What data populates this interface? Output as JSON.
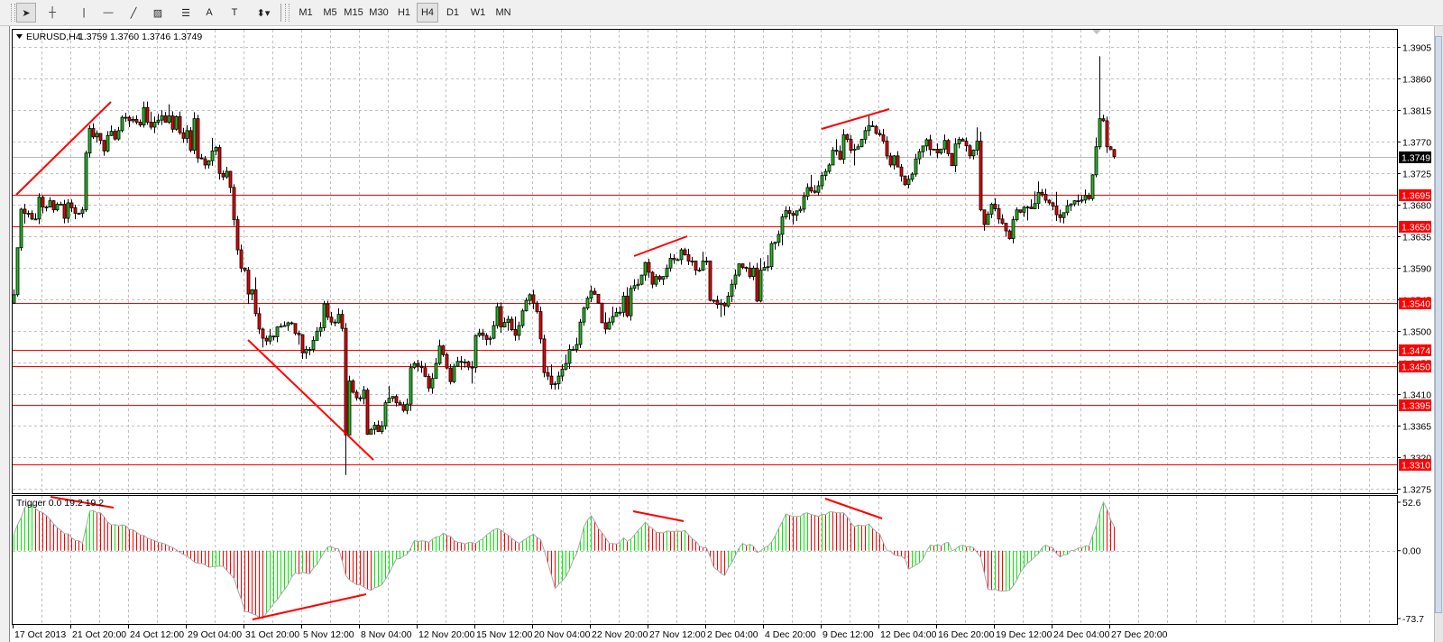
{
  "toolbar": {
    "tools": [
      {
        "name": "cursor",
        "glyph": "➤"
      },
      {
        "name": "crosshair",
        "glyph": "┼"
      },
      {
        "name": "vertical-line",
        "glyph": "|"
      },
      {
        "name": "horizontal-line",
        "glyph": "—"
      },
      {
        "name": "trendline",
        "glyph": "╱"
      },
      {
        "name": "equidistant-channel",
        "glyph": "▨"
      },
      {
        "name": "fibonacci",
        "glyph": "☰"
      },
      {
        "name": "text",
        "glyph": "A"
      },
      {
        "name": "text-label",
        "glyph": "T"
      },
      {
        "name": "arrows",
        "glyph": "⬍▾"
      }
    ],
    "timeframes": [
      "M1",
      "M5",
      "M15",
      "M30",
      "H1",
      "H4",
      "D1",
      "W1",
      "MN"
    ],
    "active_timeframe": "H4"
  },
  "chart": {
    "title": "EURUSD,H4",
    "ohlc": "1.3759 1.3760 1.3746 1.3749",
    "current_price": "1.3749",
    "indicator_label": "Trigger 0.0 19.2 19.2",
    "colors": {
      "bull": "#21b821",
      "bear": "#e60000",
      "level": "#ff0000",
      "hist_up": "#00ee00",
      "hist_down": "#ff0000",
      "line": "#a8a8a8",
      "grid": "#c0c0c0"
    }
  },
  "chart_data": {
    "type": "candlestick",
    "symbol": "EURUSD",
    "timeframe": "H4",
    "ylim": [
      1.327,
      1.392
    ],
    "price_ticks": [
      "1.3905",
      "1.3860",
      "1.3815",
      "1.3770",
      "1.3725",
      "1.3680",
      "1.3635",
      "1.3590",
      "1.3545",
      "1.3500",
      "1.3455",
      "1.3410",
      "1.3365",
      "1.3320",
      "1.3275"
    ],
    "levels": [
      "1.3695",
      "1.3650",
      "1.3540",
      "1.3474",
      "1.3450",
      "1.3395",
      "1.3310"
    ],
    "time_labels": [
      "17 Oct 2013",
      "21 Oct 20:00",
      "24 Oct 12:00",
      "29 Oct 04:00",
      "31 Oct 20:00",
      "5 Nov 12:00",
      "8 Nov 04:00",
      "12 Nov 20:00",
      "15 Nov 12:00",
      "20 Nov 04:00",
      "22 Nov 20:00",
      "27 Nov 12:00",
      "2 Dec 04:00",
      "4 Dec 20:00",
      "9 Dec 12:00",
      "12 Dec 04:00",
      "16 Dec 20:00",
      "19 Dec 12:00",
      "24 Dec 04:00",
      "27 Dec 20:00"
    ],
    "bar_count": 306,
    "first_open": 1.354,
    "close_keypoints": [
      [
        0,
        1.3552
      ],
      [
        1,
        1.3619
      ],
      [
        2,
        1.3674
      ],
      [
        3,
        1.3668
      ],
      [
        4,
        1.3668
      ],
      [
        5,
        1.366
      ],
      [
        6,
        1.366
      ],
      [
        7,
        1.3691
      ],
      [
        8,
        1.3677
      ],
      [
        9,
        1.3677
      ],
      [
        10,
        1.3686
      ],
      [
        11,
        1.3673
      ],
      [
        12,
        1.3681
      ],
      [
        13,
        1.3681
      ],
      [
        14,
        1.3661
      ],
      [
        15,
        1.3683
      ],
      [
        16,
        1.3676
      ],
      [
        17,
        1.3668
      ],
      [
        18,
        1.3668
      ],
      [
        19,
        1.3673
      ],
      [
        20,
        1.3754
      ],
      [
        21,
        1.3789
      ],
      [
        22,
        1.3777
      ],
      [
        23,
        1.3782
      ],
      [
        24,
        1.3772
      ],
      [
        25,
        1.3757
      ],
      [
        26,
        1.3779
      ],
      [
        27,
        1.3785
      ],
      [
        28,
        1.3774
      ],
      [
        29,
        1.3786
      ],
      [
        30,
        1.3805
      ],
      [
        31,
        1.3805
      ],
      [
        32,
        1.38
      ],
      [
        33,
        1.3802
      ],
      [
        34,
        1.3798
      ],
      [
        35,
        1.3794
      ],
      [
        36,
        1.3819
      ],
      [
        37,
        1.3798
      ],
      [
        38,
        1.3791
      ],
      [
        39,
        1.3798
      ],
      [
        40,
        1.3801
      ],
      [
        41,
        1.3807
      ],
      [
        42,
        1.3798
      ],
      [
        43,
        1.3807
      ],
      [
        44,
        1.3788
      ],
      [
        45,
        1.3806
      ],
      [
        46,
        1.3783
      ],
      [
        47,
        1.3775
      ],
      [
        48,
        1.3786
      ],
      [
        49,
        1.3758
      ],
      [
        50,
        1.3803
      ],
      [
        51,
        1.3747
      ],
      [
        52,
        1.3746
      ],
      [
        53,
        1.3737
      ],
      [
        54,
        1.3743
      ],
      [
        55,
        1.3757
      ],
      [
        56,
        1.3762
      ],
      [
        57,
        1.3725
      ],
      [
        58,
        1.372
      ],
      [
        59,
        1.3728
      ],
      [
        60,
        1.3705
      ],
      [
        61,
        1.3659
      ],
      [
        62,
        1.3616
      ],
      [
        63,
        1.359
      ],
      [
        64,
        1.3587
      ],
      [
        65,
        1.3553
      ],
      [
        66,
        1.3559
      ],
      [
        67,
        1.3525
      ],
      [
        68,
        1.3503
      ],
      [
        69,
        1.349
      ],
      [
        70,
        1.3486
      ],
      [
        71,
        1.3493
      ],
      [
        72,
        1.3492
      ],
      [
        73,
        1.3506
      ],
      [
        74,
        1.3507
      ],
      [
        75,
        1.3508
      ],
      [
        76,
        1.3512
      ],
      [
        77,
        1.3511
      ],
      [
        78,
        1.3497
      ],
      [
        79,
        1.3495
      ],
      [
        80,
        1.3469
      ],
      [
        81,
        1.3474
      ],
      [
        82,
        1.3474
      ],
      [
        83,
        1.3487
      ],
      [
        84,
        1.35
      ],
      [
        85,
        1.3505
      ],
      [
        86,
        1.3539
      ],
      [
        87,
        1.352
      ],
      [
        88,
        1.3513
      ],
      [
        89,
        1.3512
      ],
      [
        90,
        1.3524
      ],
      [
        91,
        1.3504
      ],
      [
        92,
        1.3352
      ],
      [
        93,
        1.3429
      ],
      [
        94,
        1.3413
      ],
      [
        95,
        1.3405
      ],
      [
        96,
        1.3404
      ],
      [
        97,
        1.3416
      ],
      [
        98,
        1.3353
      ],
      [
        99,
        1.336
      ],
      [
        100,
        1.3366
      ],
      [
        101,
        1.3357
      ],
      [
        102,
        1.3365
      ],
      [
        103,
        1.3398
      ],
      [
        105,
        1.3407
      ],
      [
        108,
        1.3387
      ],
      [
        109,
        1.3396
      ],
      [
        110,
        1.3448
      ],
      [
        113,
        1.3448
      ],
      [
        115,
        1.3419
      ],
      [
        117,
        1.3454
      ],
      [
        118,
        1.3479
      ],
      [
        121,
        1.3428
      ],
      [
        122,
        1.345
      ],
      [
        124,
        1.3456
      ],
      [
        127,
        1.3448
      ],
      [
        128,
        1.3494
      ],
      [
        130,
        1.3494
      ],
      [
        132,
        1.349
      ],
      [
        133,
        1.3508
      ],
      [
        134,
        1.3535
      ],
      [
        135,
        1.3506
      ],
      [
        137,
        1.3517
      ],
      [
        139,
        1.3494
      ],
      [
        141,
        1.3529
      ],
      [
        143,
        1.3552
      ],
      [
        144,
        1.354
      ],
      [
        145,
        1.3528
      ],
      [
        147,
        1.3441
      ],
      [
        148,
        1.3436
      ],
      [
        149,
        1.3424
      ],
      [
        150,
        1.3425
      ],
      [
        151,
        1.3436
      ],
      [
        152,
        1.3446
      ],
      [
        153,
        1.3454
      ],
      [
        154,
        1.3474
      ],
      [
        155,
        1.3474
      ],
      [
        156,
        1.3481
      ],
      [
        157,
        1.3513
      ],
      [
        158,
        1.3533
      ],
      [
        159,
        1.3547
      ],
      [
        160,
        1.3557
      ],
      [
        162,
        1.354
      ],
      [
        163,
        1.3512
      ],
      [
        164,
        1.3503
      ],
      [
        165,
        1.3513
      ],
      [
        166,
        1.3521
      ],
      [
        167,
        1.3527
      ],
      [
        168,
        1.3527
      ],
      [
        169,
        1.355
      ],
      [
        170,
        1.3522
      ],
      [
        171,
        1.3561
      ],
      [
        172,
        1.3565
      ],
      [
        173,
        1.3567
      ],
      [
        174,
        1.358
      ],
      [
        175,
        1.3598
      ],
      [
        176,
        1.3584
      ],
      [
        177,
        1.3567
      ],
      [
        178,
        1.3578
      ],
      [
        179,
        1.3574
      ],
      [
        180,
        1.3578
      ],
      [
        181,
        1.359
      ],
      [
        182,
        1.3604
      ],
      [
        183,
        1.3602
      ],
      [
        184,
        1.3602
      ],
      [
        185,
        1.3616
      ],
      [
        186,
        1.3609
      ],
      [
        187,
        1.36
      ],
      [
        188,
        1.36
      ],
      [
        189,
        1.3587
      ],
      [
        190,
        1.3587
      ],
      [
        191,
        1.36
      ],
      [
        192,
        1.36
      ],
      [
        193,
        1.3544
      ],
      [
        194,
        1.3544
      ],
      [
        195,
        1.3538
      ],
      [
        196,
        1.354
      ],
      [
        197,
        1.3536
      ],
      [
        198,
        1.355
      ],
      [
        199,
        1.3567
      ],
      [
        200,
        1.358
      ],
      [
        201,
        1.3596
      ],
      [
        202,
        1.3591
      ],
      [
        203,
        1.359
      ],
      [
        204,
        1.3578
      ],
      [
        205,
        1.359
      ],
      [
        206,
        1.3543
      ],
      [
        207,
        1.3587
      ],
      [
        208,
        1.3591
      ],
      [
        209,
        1.3592
      ],
      [
        210,
        1.3625
      ],
      [
        211,
        1.3627
      ],
      [
        212,
        1.3638
      ],
      [
        213,
        1.3663
      ],
      [
        214,
        1.3672
      ],
      [
        215,
        1.3668
      ],
      [
        218,
        1.3674
      ],
      [
        220,
        1.3705
      ],
      [
        222,
        1.3698
      ],
      [
        224,
        1.3722
      ],
      [
        226,
        1.3737
      ],
      [
        227,
        1.3758
      ],
      [
        229,
        1.3745
      ],
      [
        230,
        1.378
      ],
      [
        232,
        1.3758
      ],
      [
        234,
        1.3763
      ],
      [
        236,
        1.3786
      ],
      [
        238,
        1.3792
      ],
      [
        240,
        1.378
      ],
      [
        241,
        1.3771
      ],
      [
        243,
        1.3737
      ],
      [
        244,
        1.375
      ],
      [
        247,
        1.3709
      ],
      [
        249,
        1.3724
      ],
      [
        251,
        1.3756
      ],
      [
        253,
        1.3773
      ],
      [
        254,
        1.3759
      ],
      [
        256,
        1.3754
      ],
      [
        258,
        1.3772
      ],
      [
        260,
        1.3736
      ],
      [
        261,
        1.3767
      ],
      [
        263,
        1.3771
      ],
      [
        265,
        1.375
      ],
      [
        267,
        1.3771
      ],
      [
        268,
        1.3673
      ],
      [
        269,
        1.3652
      ],
      [
        271,
        1.3681
      ],
      [
        273,
        1.366
      ],
      [
        275,
        1.3643
      ],
      [
        276,
        1.3632
      ],
      [
        277,
        1.3659
      ],
      [
        278,
        1.3673
      ],
      [
        281,
        1.3677
      ],
      [
        283,
        1.3682
      ],
      [
        284,
        1.3698
      ],
      [
        287,
        1.3683
      ],
      [
        290,
        1.3662
      ],
      [
        292,
        1.3679
      ],
      [
        294,
        1.3686
      ],
      [
        296,
        1.3687
      ],
      [
        298,
        1.3689
      ],
      [
        299,
        1.3723
      ],
      [
        300,
        1.3763
      ],
      [
        301,
        1.3803
      ],
      [
        302,
        1.38
      ],
      [
        303,
        1.3763
      ],
      [
        304,
        1.3759
      ],
      [
        305,
        1.3749
      ]
    ],
    "wick_overrides": [
      [
        92,
        null,
        1.3295
      ],
      [
        301,
        1.3892,
        null
      ],
      [
        305,
        1.376,
        1.3746
      ]
    ],
    "indicator": {
      "name": "Trigger",
      "ylim": [
        -73.7,
        52.6
      ],
      "tick_labels": [
        "52.6",
        "0.00",
        "-73.7"
      ],
      "keypoints": [
        [
          0,
          18
        ],
        [
          3,
          47
        ],
        [
          5,
          50
        ],
        [
          9,
          38
        ],
        [
          12,
          25
        ],
        [
          16,
          14
        ],
        [
          19,
          8
        ],
        [
          21,
          43
        ],
        [
          24,
          41
        ],
        [
          27,
          28
        ],
        [
          31,
          27
        ],
        [
          35,
          17
        ],
        [
          40,
          9
        ],
        [
          45,
          1
        ],
        [
          49,
          -9
        ],
        [
          54,
          -18
        ],
        [
          58,
          -17
        ],
        [
          61,
          -30
        ],
        [
          64,
          -66
        ],
        [
          69,
          -73.7
        ],
        [
          73,
          -53
        ],
        [
          78,
          -24
        ],
        [
          82,
          -25
        ],
        [
          85,
          -8
        ],
        [
          87,
          4
        ],
        [
          90,
          2
        ],
        [
          92,
          -27
        ],
        [
          95,
          -37
        ],
        [
          99,
          -43
        ],
        [
          102,
          -37
        ],
        [
          106,
          -9
        ],
        [
          109,
          -4
        ],
        [
          111,
          11
        ],
        [
          115,
          9
        ],
        [
          119,
          19
        ],
        [
          123,
          9
        ],
        [
          128,
          8
        ],
        [
          134,
          24
        ],
        [
          140,
          8
        ],
        [
          144,
          18
        ],
        [
          146,
          12
        ],
        [
          147,
          0
        ],
        [
          150,
          -41
        ],
        [
          153,
          -28
        ],
        [
          156,
          -3
        ],
        [
          158,
          26
        ],
        [
          160,
          38
        ],
        [
          162,
          24
        ],
        [
          165,
          8
        ],
        [
          168,
          9
        ],
        [
          169,
          14
        ],
        [
          170,
          10
        ],
        [
          173,
          22
        ],
        [
          175,
          31
        ],
        [
          178,
          20
        ],
        [
          183,
          21
        ],
        [
          186,
          22
        ],
        [
          188,
          13
        ],
        [
          190,
          5
        ],
        [
          192,
          3
        ],
        [
          194,
          -18
        ],
        [
          197,
          -27
        ],
        [
          200,
          -5
        ],
        [
          202,
          8
        ],
        [
          205,
          5
        ],
        [
          206,
          -2
        ],
        [
          209,
          5
        ],
        [
          211,
          16
        ],
        [
          214,
          40
        ],
        [
          217,
          37
        ],
        [
          220,
          41
        ],
        [
          223,
          37
        ],
        [
          227,
          42
        ],
        [
          230,
          41
        ],
        [
          233,
          26
        ],
        [
          237,
          29
        ],
        [
          240,
          18
        ],
        [
          242,
          0
        ],
        [
          247,
          -9
        ],
        [
          248,
          -20
        ],
        [
          252,
          -9
        ],
        [
          254,
          6
        ],
        [
          257,
          5
        ],
        [
          259,
          9
        ],
        [
          260,
          0
        ],
        [
          263,
          6
        ],
        [
          266,
          3
        ],
        [
          268,
          -7
        ],
        [
          270,
          -42
        ],
        [
          276,
          -43
        ],
        [
          280,
          -18
        ],
        [
          286,
          6
        ],
        [
          288,
          3
        ],
        [
          290,
          -7
        ],
        [
          295,
          3
        ],
        [
          298,
          5
        ],
        [
          302,
          52.6
        ],
        [
          305,
          26
        ]
      ]
    }
  }
}
